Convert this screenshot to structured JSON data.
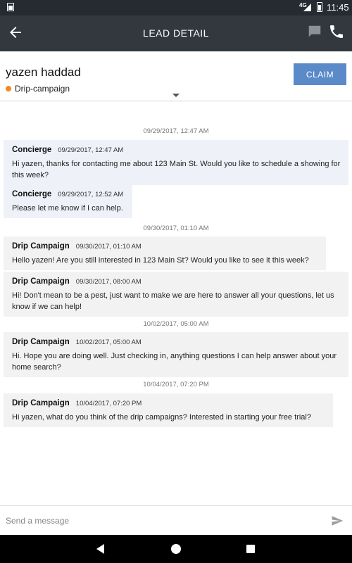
{
  "status_bar": {
    "time": "11:45",
    "network": "4G"
  },
  "app_bar": {
    "title": "LEAD DETAIL",
    "back_icon": "arrow-back",
    "chat_icon": "chat-bubble",
    "phone_icon": "phone"
  },
  "lead": {
    "name": "yazen haddad",
    "source": "Drip-campaign",
    "source_color": "#f28a1e",
    "claim_label": "CLAIM"
  },
  "messages": [
    {
      "date": "09/29/2017, 12:47 AM"
    },
    {
      "sender": "Concierge",
      "time": "09/29/2017, 12:47 AM",
      "text": "Hi yazen, thanks for contacting me about 123 Main St. Would you like to schedule a showing for this week?"
    },
    {
      "sender": "Concierge",
      "time": "09/29/2017, 12:52 AM",
      "text": "Please let me know if I can help."
    },
    {
      "date": "09/30/2017, 01:10 AM"
    },
    {
      "sender": "Drip Campaign",
      "time": "09/30/2017, 01:10 AM",
      "text": "Hello yazen! Are you still interested in 123 Main St? Would you like to see it this week?"
    },
    {
      "sender": "Drip Campaign",
      "time": "09/30/2017, 08:00 AM",
      "text": "Hi! Don't mean to be a pest, just want to make we are here to answer all your questions, let us know if we can help!"
    },
    {
      "date": "10/02/2017, 05:00 AM"
    },
    {
      "sender": "Drip Campaign",
      "time": "10/02/2017, 05:00 AM",
      "text": "Hi. Hope you are doing well. Just checking in, anything questions I can help answer about your home search?"
    },
    {
      "date": "10/04/2017, 07:20 PM"
    },
    {
      "sender": "Drip Campaign",
      "time": "10/04/2017, 07:20 PM",
      "text": "Hi yazen, what do you think of the drip campaigns? Interested in starting your free trial?"
    }
  ],
  "composer": {
    "placeholder": "Send a message",
    "send_icon": "send"
  },
  "colors": {
    "app_bar": "#33383f",
    "status_bar": "#262b31",
    "claim_button": "#5b8ac9",
    "concierge_bubble": "#eef1f8",
    "drip_bubble": "#f2f2f2"
  }
}
